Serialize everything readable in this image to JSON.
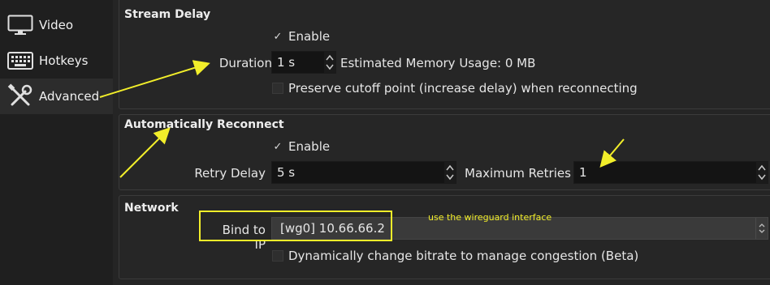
{
  "sidebar": {
    "items": [
      {
        "label": "Video",
        "icon": "monitor-icon"
      },
      {
        "label": "Hotkeys",
        "icon": "keyboard-icon"
      },
      {
        "label": "Advanced",
        "icon": "wrench-screwdriver-icon"
      }
    ],
    "active_index": 2
  },
  "stream_delay": {
    "title": "Stream Delay",
    "enable_label": "Enable",
    "enable_checked": true,
    "duration_label": "Duration",
    "duration_value": "1 s",
    "memory_label": "Estimated Memory Usage: 0 MB",
    "preserve_label": "Preserve cutoff point (increase delay) when reconnecting",
    "preserve_checked": false
  },
  "auto_reconnect": {
    "title": "Automatically Reconnect",
    "enable_label": "Enable",
    "enable_checked": true,
    "retry_delay_label": "Retry Delay",
    "retry_delay_value": "5 s",
    "max_retries_label": "Maximum Retries",
    "max_retries_value": "1"
  },
  "network": {
    "title": "Network",
    "bind_ip_label": "Bind to IP",
    "bind_ip_value": "[wg0] 10.66.66.2",
    "dynamic_bitrate_label": "Dynamically change bitrate to manage congestion (Beta)",
    "dynamic_bitrate_checked": false
  },
  "annotation": {
    "text": "use the wireguard interface",
    "color": "#f2ee2a"
  },
  "colors": {
    "background": "#1e1e1e",
    "panel": "#262626",
    "field": "#141414",
    "highlight": "#f2ee2a"
  }
}
